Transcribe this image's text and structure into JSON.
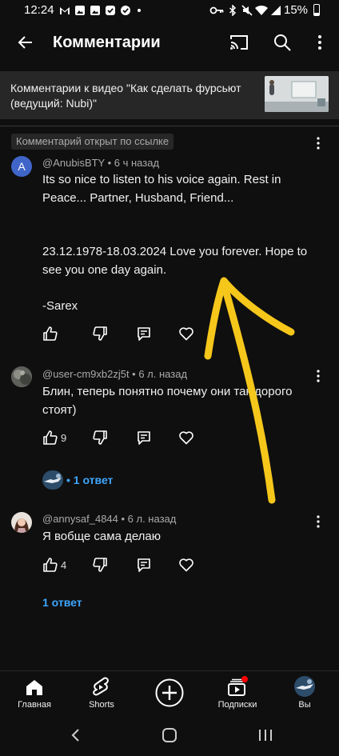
{
  "status_bar": {
    "time": "12:24",
    "battery": "15%",
    "left_icons": [
      "gmail-icon",
      "gallery-icon",
      "gallery-icon",
      "check-circle-icon",
      "dot-icon"
    ],
    "right_icons": [
      "key-icon",
      "bluetooth-icon",
      "mute-icon",
      "wifi-icon",
      "signal-icon",
      "battery-icon"
    ]
  },
  "app_bar": {
    "title": "Комментарии",
    "icons": [
      "back-arrow-icon",
      "cast-icon",
      "search-icon",
      "more-vert-icon"
    ]
  },
  "video": {
    "title": "Комментарии к видео \"Как сделать фурсьют (ведущий: Nubi)\""
  },
  "linked_badge": "Комментарий открыт по ссылке",
  "comments": [
    {
      "avatar_letter": "A",
      "avatar_color": "#3f65c8",
      "meta": "@AnubisBTY • 6 ч назад",
      "text": "Its so nice to listen to his voice again. Rest in Peace... Partner, Husband, Friend...\n\n\n23.12.1978-18.03.2024 Love you forever. Hope to see you one day again.\n\n-Sarex",
      "likes": ""
    },
    {
      "meta": "@user-cm9xb2zj5t • 6 л. назад",
      "text": "Блин, теперь понятно почему они так дорого стоят)",
      "likes": "9",
      "replies": "• 1 ответ"
    },
    {
      "meta": "@annysaf_4844 • 6 л. назад",
      "text": "Я вобще сама делаю",
      "likes": "4",
      "replies": "1 ответ"
    }
  ],
  "bottom_nav": {
    "items": [
      {
        "label": "Главная",
        "icon": "home-icon"
      },
      {
        "label": "Shorts",
        "icon": "shorts-icon"
      },
      {
        "label": "",
        "icon": "create-plus-icon"
      },
      {
        "label": "Подписки",
        "icon": "subscriptions-icon"
      },
      {
        "label": "Вы",
        "icon": "profile-avatar-icon"
      }
    ]
  },
  "system_nav": [
    "recent-apps-icon",
    "home-circle-icon",
    "back-chevron-icon"
  ],
  "annotation": {
    "type": "hand-drawn-arrow",
    "color": "#f6c71b"
  }
}
